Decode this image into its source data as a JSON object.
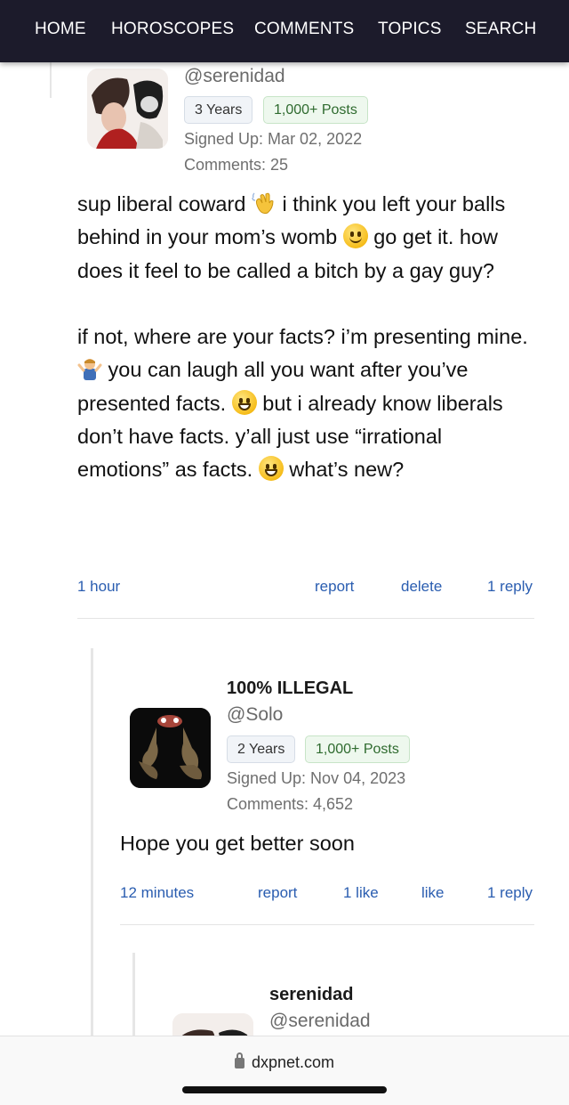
{
  "nav": {
    "items": [
      "HOME",
      "HOROSCOPES",
      "COMMENTS",
      "TOPICS",
      "SEARCH"
    ]
  },
  "comments": [
    {
      "handle": "@serenidad",
      "years_badge": "3 Years",
      "posts_badge": "1,000+ Posts",
      "signed_up": "Signed Up: Mar 02, 2022",
      "comments_count": "Comments: 25",
      "body": {
        "p1_a": "sup liberal coward",
        "p1_b": "i think you left your balls behind in your mom’s womb",
        "p1_c": "go get it. how does it feel to be called a bitch by a gay guy?",
        "p2_a": "if not, where are your facts? i’m presenting mine.",
        "p2_b": "you can laugh all you want after you’ve presented facts.",
        "p2_c": "but i already know liberals don’t have facts. y’all just use “irrational emotions” as facts.",
        "p2_d": "what’s new?"
      },
      "actions": {
        "time": "1 hour",
        "report": "report",
        "delete": "delete",
        "reply": "1 reply"
      }
    },
    {
      "name": "100% ILLEGAL",
      "handle": "@Solo",
      "years_badge": "2 Years",
      "posts_badge": "1,000+ Posts",
      "signed_up": "Signed Up: Nov 04, 2023",
      "comments_count": "Comments: 4,652",
      "body": "Hope you get better soon",
      "actions": {
        "time": "12 minutes",
        "report": "report",
        "likes": "1 like",
        "like": "like",
        "reply": "1 reply"
      }
    },
    {
      "name": "serenidad",
      "handle": "@serenidad"
    }
  ],
  "browser": {
    "url": "dxpnet.com"
  },
  "colors": {
    "nav_bg": "#1c1b2b",
    "link": "#2a5db0"
  }
}
